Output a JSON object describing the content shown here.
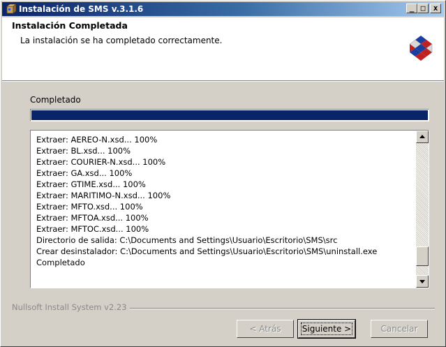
{
  "window": {
    "title": "Instalación de SMS v.3.1.6",
    "minimize_glyph": "_",
    "maximize_glyph": "□",
    "close_glyph": "x"
  },
  "header": {
    "title": "Instalación Completada",
    "subtitle": "La instalación se ha completado correctamente."
  },
  "progress": {
    "label": "Completado",
    "fraction": 1.0
  },
  "log": {
    "lines": [
      "Extraer: AEREO-N.xsd... 100%",
      "Extraer: BL.xsd... 100%",
      "Extraer: COURIER-N.xsd... 100%",
      "Extraer: GA.xsd... 100%",
      "Extraer: GTIME.xsd... 100%",
      "Extraer: MARITIMO-N.xsd... 100%",
      "Extraer: MFTO.xsd... 100%",
      "Extraer: MFTOA.xsd... 100%",
      "Extraer: MFTOC.xsd... 100%",
      "Directorio de salida: C:\\Documents and Settings\\Usuario\\Escritorio\\SMS\\src",
      "Crear desinstalador: C:\\Documents and Settings\\Usuario\\Escritorio\\SMS\\uninstall.exe",
      "Completado"
    ],
    "scroll_position": 0.92
  },
  "footer": {
    "brand": "Nullsoft Install System v2.23"
  },
  "buttons": {
    "back": "< Atrás",
    "next": "Siguiente >",
    "cancel": "Cancelar"
  },
  "colors": {
    "progress_fill": "#0a246a",
    "titlebar_start": "#0a246a",
    "titlebar_end": "#a6caf0"
  }
}
